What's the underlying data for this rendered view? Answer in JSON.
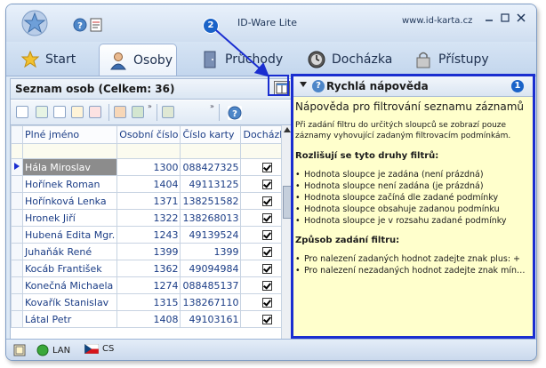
{
  "app": {
    "title": "ID-Ware Lite",
    "url": "www.id-karta.cz"
  },
  "tabs": [
    {
      "label": "Start",
      "icon": "star-icon",
      "active": false
    },
    {
      "label": "Osoby",
      "icon": "person-icon",
      "active": true
    },
    {
      "label": "Průchody",
      "icon": "door-icon",
      "active": false
    },
    {
      "label": "Docházka",
      "icon": "clock-icon",
      "active": false
    },
    {
      "label": "Přístupy",
      "icon": "lock-icon",
      "active": false
    }
  ],
  "people": {
    "title": "Seznam osob (Celkem: 36)",
    "columns": [
      "Plné jméno",
      "Osobní číslo",
      "Číslo karty",
      "Docházka"
    ],
    "rows": [
      {
        "name": "Hála Miroslav",
        "personal": "1300",
        "card": "088427325",
        "attendance": true,
        "selected": true
      },
      {
        "name": "Hořínek Roman",
        "personal": "1404",
        "card": "49113125",
        "attendance": true
      },
      {
        "name": "Hořínková Lenka",
        "personal": "1371",
        "card": "138251582",
        "attendance": true
      },
      {
        "name": "Hronek Jiří",
        "personal": "1322",
        "card": "138268013",
        "attendance": true
      },
      {
        "name": "Hubená Edita Mgr.",
        "personal": "1243",
        "card": "49139524",
        "attendance": true
      },
      {
        "name": "Juhaňák René",
        "personal": "1399",
        "card": "1399",
        "attendance": true
      },
      {
        "name": "Kocáb František",
        "personal": "1362",
        "card": "49094984",
        "attendance": true
      },
      {
        "name": "Konečná Michaela",
        "personal": "1274",
        "card": "088485137",
        "attendance": true
      },
      {
        "name": "Kovařík Stanislav",
        "personal": "1315",
        "card": "138267110",
        "attendance": true
      },
      {
        "name": "Látal Petr",
        "personal": "1408",
        "card": "49103161",
        "attendance": true
      }
    ]
  },
  "help": {
    "title": "Rychlá nápověda",
    "badge1": "1",
    "badge2": "2",
    "heading": "Nápověda pro filtrování seznamu záznamů",
    "intro": "Při zadání filtru do určitých sloupců se zobrazí pouze záznamy vyhovující zadaným filtrovacím podmínkám.",
    "section1": "Rozlišují se tyto druhy filtrů:",
    "filters": [
      "Hodnota sloupce je zadána (není prázdná)",
      "Hodnota sloupce není zadána (je prázdná)",
      "Hodnota sloupce začíná dle zadané podmínky",
      "Hodnota sloupce obsahuje zadanou podmínku",
      "Hodnota sloupce je v rozsahu zadané podmínky"
    ],
    "section2": "Způsob zadání filtru:",
    "methods": [
      "Pro nalezení zadaných hodnot zadejte znak plus: +",
      "Pro nalezení nezadaných hodnot zadejte znak mín…"
    ]
  },
  "status": {
    "network": "LAN",
    "language": "CS"
  },
  "colors": {
    "accent": "#1a2ed0",
    "help_bg": "#ffffcc",
    "badge": "#1a63c8"
  }
}
